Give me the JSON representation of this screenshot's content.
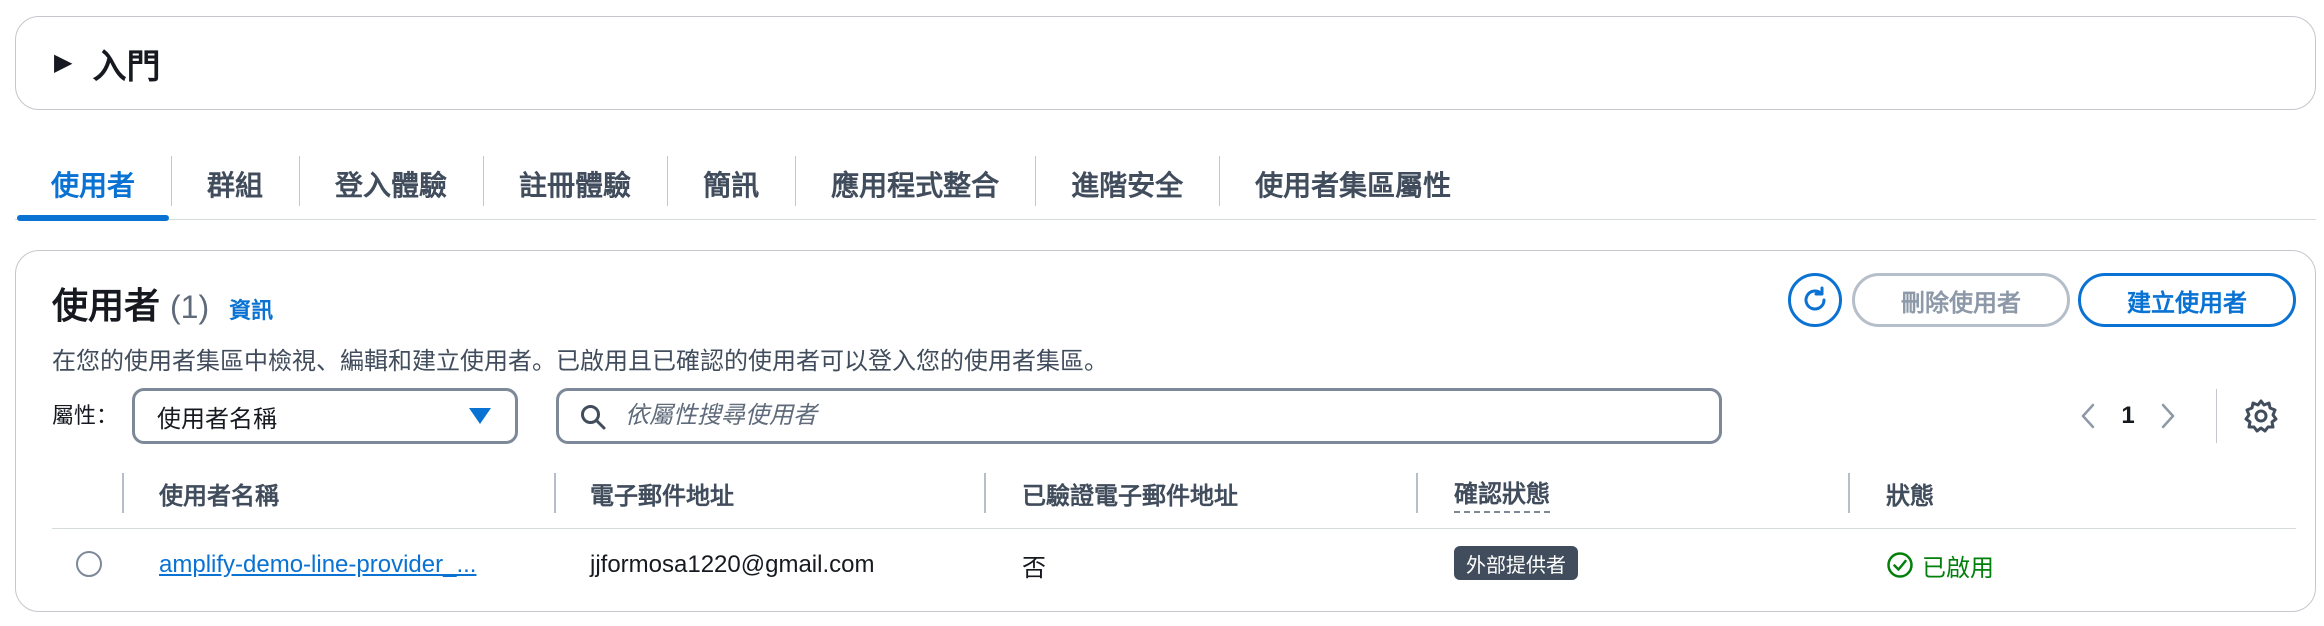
{
  "intro": {
    "caret": "▶",
    "title": "入門"
  },
  "tabs": [
    {
      "label": "使用者",
      "active": true
    },
    {
      "label": "群組"
    },
    {
      "label": "登入體驗"
    },
    {
      "label": "註冊體驗"
    },
    {
      "label": "簡訊"
    },
    {
      "label": "應用程式整合"
    },
    {
      "label": "進階安全"
    },
    {
      "label": "使用者集區屬性"
    }
  ],
  "users_panel": {
    "title": "使用者",
    "count": "(1)",
    "info_link": "資訊",
    "description": "在您的使用者集區中檢視、編輯和建立使用者。已啟用且已確認的使用者可以登入您的使用者集區。",
    "delete_button": "刪除使用者",
    "create_button": "建立使用者",
    "attribute_label": "屬性：",
    "attribute_value": "使用者名稱",
    "search_placeholder": "依屬性搜尋使用者",
    "page_number": "1"
  },
  "table": {
    "columns": [
      "使用者名稱",
      "電子郵件地址",
      "已驗證電子郵件地址",
      "確認狀態",
      "狀態"
    ],
    "rows": [
      {
        "username": "amplify-demo-line-provider_...",
        "email": "jjformosa1220@gmail.com",
        "email_verified": "否",
        "confirmation_status": "外部提供者",
        "status": "已啟用"
      }
    ]
  },
  "colors": {
    "accent": "#0972d3",
    "success": "#037f0c",
    "badge_bg": "#414d5c"
  }
}
